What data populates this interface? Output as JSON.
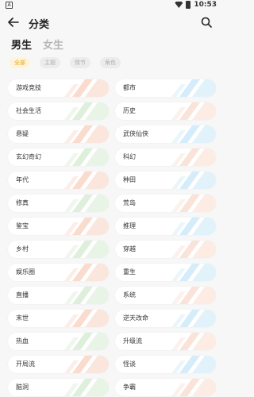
{
  "status": {
    "time": "10:53",
    "left_icon": "A"
  },
  "header": {
    "title": "分类"
  },
  "gender": {
    "male": "男生",
    "female": "女生"
  },
  "filters": [
    "全部",
    "主题",
    "情节",
    "角色"
  ],
  "categories": [
    [
      "游戏竞技",
      "都市"
    ],
    [
      "社会生活",
      "历史"
    ],
    [
      "悬疑",
      "武侠仙侠"
    ],
    [
      "玄幻奇幻",
      "科幻"
    ],
    [
      "年代",
      "种田"
    ],
    [
      "修真",
      "荒岛"
    ],
    [
      "鉴宝",
      "推理"
    ],
    [
      "乡村",
      "穿越"
    ],
    [
      "娱乐圈",
      "重生"
    ],
    [
      "直播",
      "系统"
    ],
    [
      "末世",
      "逆天改命"
    ],
    [
      "热血",
      "升级流"
    ],
    [
      "开局流",
      "怪谈"
    ],
    [
      "脑洞",
      "争霸"
    ]
  ],
  "colors": {
    "accent": "#e0a52a",
    "stripe_colors": [
      "#f7c9b6",
      "#bfe3f7",
      "#cde7c9",
      "#f8d5c3"
    ]
  }
}
